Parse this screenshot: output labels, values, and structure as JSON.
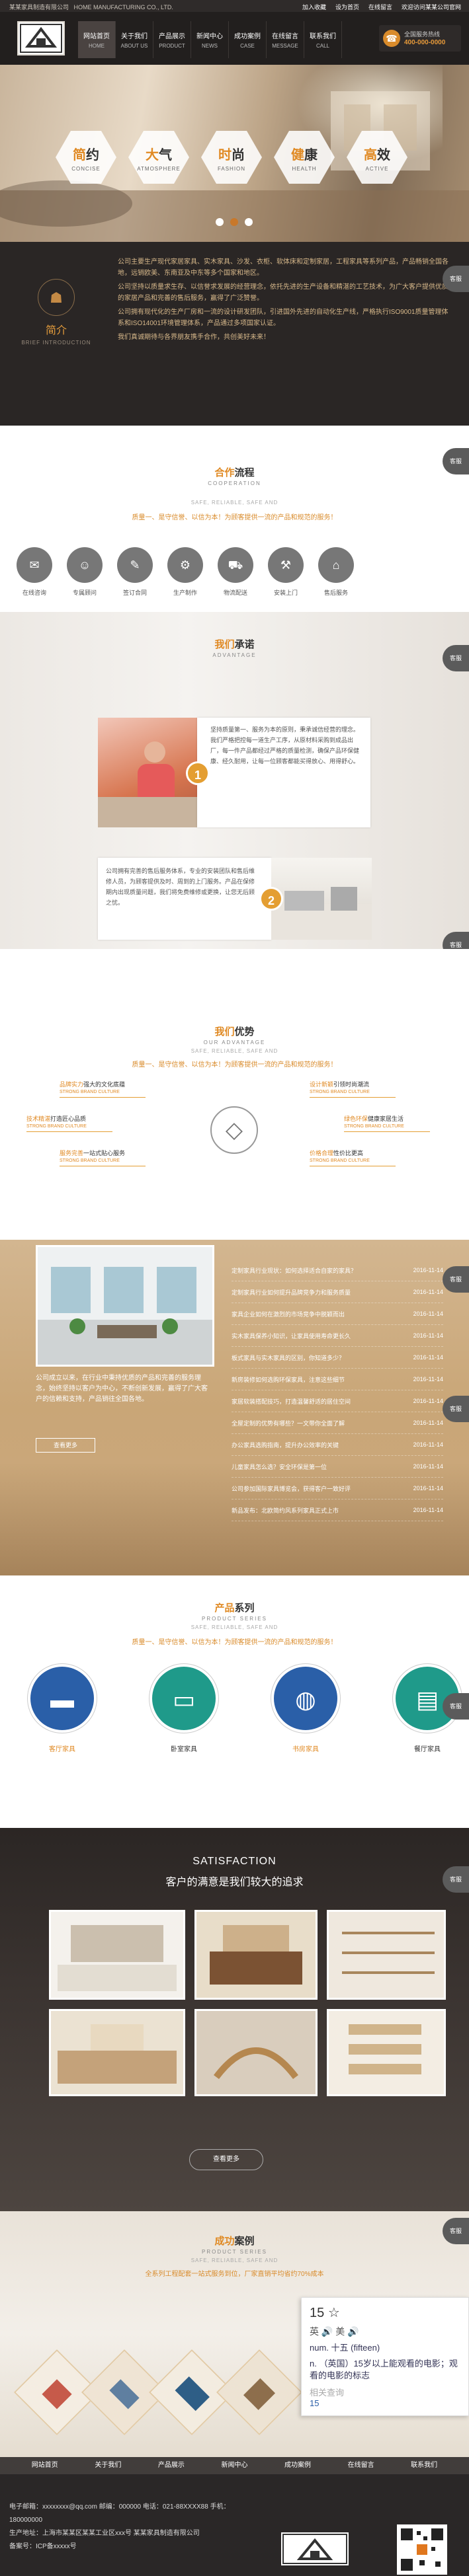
{
  "topbar": {
    "company": "某某家具制造有限公司",
    "company_en": "HOME MANUFACTURING CO., LTD.",
    "links": [
      "加入收藏",
      "设为首页",
      "在线留言"
    ],
    "welcome": "欢迎访问某某公司官网"
  },
  "nav": [
    {
      "cn": "网站首页",
      "en": "HOME"
    },
    {
      "cn": "关于我们",
      "en": "ABOUT US"
    },
    {
      "cn": "产品展示",
      "en": "PRODUCT"
    },
    {
      "cn": "新闻中心",
      "en": "NEWS"
    },
    {
      "cn": "成功案例",
      "en": "CASE"
    },
    {
      "cn": "在线留言",
      "en": "MESSAGE"
    },
    {
      "cn": "联系我们",
      "en": "CALL"
    }
  ],
  "hotline": {
    "label": "全国服务热线",
    "number": "400-000-0000"
  },
  "banner": {
    "features": [
      {
        "hl": "简",
        "rest": "约",
        "en": "CONCISE"
      },
      {
        "hl": "大",
        "rest": "气",
        "en": "ATMOSPHERE"
      },
      {
        "hl": "时",
        "rest": "尚",
        "en": "FASHION"
      },
      {
        "hl": "健",
        "rest": "康",
        "en": "HEALTH"
      },
      {
        "hl": "高",
        "rest": "效",
        "en": "ACTIVE"
      }
    ]
  },
  "intro": {
    "title": "简介",
    "en": "BRIEF INTRODUCTION",
    "paragraphs": [
      "公司主要生产现代家居家具、实木家具、沙发、衣柜、软体床和定制家居，工程家具等系列产品，产品畅销全国各地，远销欧美、东南亚及中东等多个国家和地区。",
      "公司坚持以质量求生存、以信誉求发展的经营理念，依托先进的生产设备和精湛的工艺技术，为广大客户提供优质的家居产品和完善的售后服务，赢得了广泛赞誉。",
      "公司拥有现代化的生产厂房和一流的设计研发团队，引进国外先进的自动化生产线，严格执行ISO9001质量管理体系和ISO14001环境管理体系，产品通过多项国家认证。",
      "我们真诚期待与各界朋友携手合作，共创美好未来！"
    ]
  },
  "side_tab": "客服",
  "coop": {
    "title_hl": "合作",
    "title_rest": "流程",
    "en": "COOPERATION",
    "subline": "SAFE, RELIABLE, SAFE AND",
    "tagline": "质量一、是守信誉、以信为本！为顾客提供一流的产品和规范的服务！",
    "steps": [
      "在线咨询",
      "专属顾问",
      "签订合同",
      "生产制作",
      "物流配送",
      "安装上门",
      "售后服务"
    ]
  },
  "advantage": {
    "title_hl": "我们",
    "title_rest": "承诺",
    "en": "ADVANTAGE",
    "items": [
      {
        "num": "1",
        "text": "坚持质量第一、服务为本的原则，秉承诚信经营的理念。我们严格把控每一道生产工序，从原材料采购到成品出厂，每一件产品都经过严格的质量检测，确保产品环保健康、经久耐用，让每一位顾客都能买得放心、用得舒心。"
      },
      {
        "num": "2",
        "text": "公司拥有完善的售后服务体系，专业的安装团队和售后维修人员，为顾客提供及时、周到的上门服务。产品在保修期内出现质量问题，我们将免费维修或更换，让您无后顾之忧。"
      }
    ]
  },
  "ours": {
    "title_hl": "我们",
    "title_rest": "优势",
    "en": "OUR ADVANTAGE",
    "subline": "SAFE, RELIABLE, SAFE AND",
    "tagline": "质量一、是守信誉、以信为本！为顾客提供一流的产品和规范的服务！",
    "left": [
      {
        "a": "品牌实力",
        "b": "强大的文化底蕴",
        "en": "STRONG BRAND CULTURE"
      },
      {
        "a": "技术精湛",
        "b": "打造匠心品质",
        "en": "STRONG BRAND CULTURE"
      },
      {
        "a": "服务完善",
        "b": "一站式贴心服务",
        "en": "STRONG BRAND CULTURE"
      }
    ],
    "right": [
      {
        "a": "设计新颖",
        "b": "引领时尚潮流",
        "en": "STRONG BRAND CULTURE"
      },
      {
        "a": "绿色环保",
        "b": "健康家居生活",
        "en": "STRONG BRAND CULTURE"
      },
      {
        "a": "价格合理",
        "b": "性价比更高",
        "en": "STRONG BRAND CULTURE"
      }
    ]
  },
  "news": {
    "intro": "公司成立以来，在行业中秉持优质的产品和完善的服务理念，始终坚持以客户为中心，不断创新发展，赢得了广大客户的信赖和支持，产品销往全国各地。",
    "more": "查看更多",
    "items": [
      {
        "title": "定制家具行业现状：如何选择适合自家的家具？",
        "date": "2016-11-14"
      },
      {
        "title": "定制家具行业如何提升品牌竞争力和服务质量",
        "date": "2016-11-14"
      },
      {
        "title": "家具企业如何在激烈的市场竞争中脱颖而出",
        "date": "2016-11-14"
      },
      {
        "title": "实木家具保养小知识，让家具使用寿命更长久",
        "date": "2016-11-14"
      },
      {
        "title": "板式家具与实木家具的区别，你知道多少？",
        "date": "2016-11-14"
      },
      {
        "title": "新房装修如何选购环保家具，注意这些细节",
        "date": "2016-11-14"
      },
      {
        "title": "家居软装搭配技巧，打造温馨舒适的居住空间",
        "date": "2016-11-14"
      },
      {
        "title": "全屋定制的优势有哪些？一文带你全面了解",
        "date": "2016-11-14"
      },
      {
        "title": "办公家具选购指南，提升办公效率的关键",
        "date": "2016-11-14"
      },
      {
        "title": "儿童家具怎么选？安全环保是第一位",
        "date": "2016-11-14"
      },
      {
        "title": "公司参加国际家具博览会，获得客户一致好评",
        "date": "2016-11-14"
      },
      {
        "title": "新品发布：北欧简约风系列家具正式上市",
        "date": "2016-11-14"
      }
    ]
  },
  "products": {
    "title_hl": "产品",
    "title_rest": "系列",
    "en": "PRODUCT SERIES",
    "subline": "SAFE, RELIABLE, SAFE AND",
    "tagline": "质量一、是守信誉、以信为本！为顾客提供一流的产品和规范的服务！",
    "items": [
      {
        "label": "客厅家具",
        "color": "#2a5fa8",
        "icon": "sofa-icon"
      },
      {
        "label": "卧室家具",
        "color": "#1f9a8a",
        "icon": "bed-icon"
      },
      {
        "label": "书房家具",
        "color": "#2a5fa8",
        "icon": "chair-icon"
      },
      {
        "label": "餐厅家具",
        "color": "#1f9a8a",
        "icon": "table-icon"
      }
    ]
  },
  "satisfaction": {
    "en": "SATISFACTION",
    "title": "客户的满意是我们较大的追求",
    "more": "查看更多"
  },
  "cases": {
    "title_hl": "成功",
    "title_rest": "案例",
    "en": "PRODUCT SERIES",
    "subline": "SAFE, RELIABLE, SAFE AND",
    "tagline": "全系列工程配套一站式服务到位，厂家直销平均省约70%成本"
  },
  "dictionary": {
    "word": "15",
    "phon": "英 🔊    美 🔊",
    "meaning1": "num. 十五 (fifteen)",
    "meaning2": "n. （英国）15岁以上能观看的电影；观看的电影的标志",
    "related": "相关查询",
    "related_val": "15"
  },
  "footer": {
    "nav": [
      "网站首页",
      "关于我们",
      "产品展示",
      "新闻中心",
      "成功案例",
      "在线留言",
      "联系我们"
    ],
    "email": "电子邮箱：xxxxxxxx@qq.com  邮编：000000  电话：021-88XXXX88  手机：180000000",
    "address": "生产地址：上海市某某区某某工业区xxx号 某某家具制造有限公司",
    "icp": "备案号：ICP备xxxxx号"
  }
}
